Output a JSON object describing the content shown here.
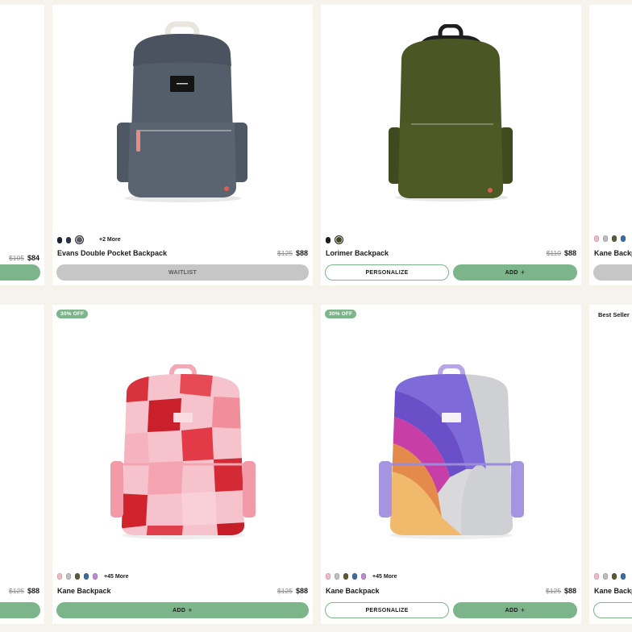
{
  "colors": {
    "accent": "#7cb58a",
    "background": "#f6f3ec",
    "waitlist": "#c6c6c6"
  },
  "row1": {
    "edge_left": {
      "price_was": "$105",
      "price_now": "$84"
    },
    "card1": {
      "name": "Evans Double Pocket Backpack",
      "price_was": "$125",
      "price_now": "$88",
      "more": "+2 More",
      "swatches": [
        "#1c2333",
        "#2b3346",
        "#555c66"
      ],
      "button": "WAITLIST"
    },
    "card2": {
      "name": "Lorimer Backpack",
      "price_was": "$110",
      "price_now": "$88",
      "swatches": [
        "#1c1c1c",
        "#3f4a22"
      ],
      "personalize": "PERSONALIZE",
      "add": "ADD",
      "add_icon": "+"
    },
    "edge_right": {
      "name": "Kane Backp",
      "swatches": [
        "#f2b8c6",
        "#bcbcbc",
        "#5d5a3a",
        "#3c6d9e"
      ]
    }
  },
  "row2": {
    "edge_left": {
      "price_was": "$125",
      "price_now": "$88"
    },
    "card1": {
      "badge": "30% OFF",
      "name": "Kane Backpack",
      "price_was": "$125",
      "price_now": "$88",
      "more": "+45 More",
      "swatches": [
        "#f2b8c6",
        "#bfbfbf",
        "#5d5a3a",
        "#3c6d9e",
        "#b98bd6"
      ],
      "add": "ADD",
      "add_icon": "+"
    },
    "card2": {
      "badge": "30% OFF",
      "name": "Kane Backpack",
      "price_was": "$125",
      "price_now": "$88",
      "more": "+45 More",
      "swatches": [
        "#f2b8c6",
        "#bfbfbf",
        "#5d5a3a",
        "#3c6d9e",
        "#b98bd6"
      ],
      "personalize": "PERSONALIZE",
      "add": "ADD",
      "add_icon": "+"
    },
    "edge_right": {
      "badge": "Best Seller",
      "name": "Kane Backp",
      "swatches": [
        "#f2b8c6",
        "#bcbcbc",
        "#5d5a3a",
        "#3c6d9e"
      ]
    }
  },
  "images": {
    "evans": "evans-backpack-navy-image",
    "lorimer": "lorimer-backpack-olive-image",
    "kane_checker": "kane-backpack-pink-checker-image",
    "kane_rainbow": "kane-backpack-rainbow-image"
  }
}
